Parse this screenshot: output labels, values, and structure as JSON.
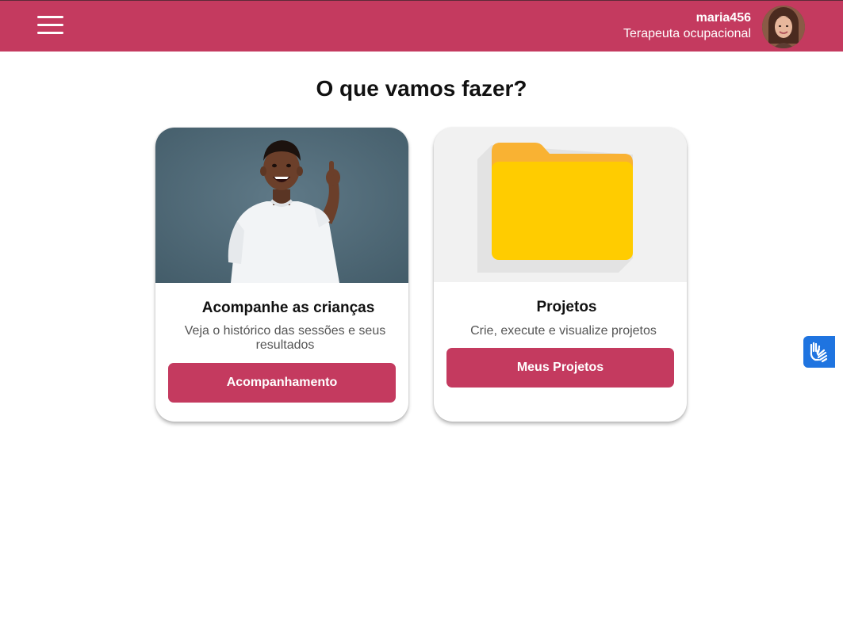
{
  "header": {
    "user_name": "maria456",
    "user_role": "Terapeuta ocupacional",
    "menu_icon": "hamburger-menu-icon",
    "avatar": "user-avatar-photo"
  },
  "main": {
    "title": "O que vamos fazer?",
    "cards": [
      {
        "title": "Acompanhe as crianças",
        "description": "Veja o histórico das sessões e seus resultados",
        "button_label": "Acompanhamento",
        "image": "smiling-child-pointing-up-photo"
      },
      {
        "title": "Projetos",
        "description": "Crie, execute e visualize projetos",
        "button_label": "Meus Projetos",
        "image": "yellow-folder-icon"
      }
    ]
  },
  "accessibility": {
    "icon": "sign-language-hands-icon"
  },
  "colors": {
    "brand": "#c43a5f",
    "accessibility_button": "#1f74e0",
    "folder_front": "#ffcc00",
    "folder_back": "#f9b233"
  }
}
